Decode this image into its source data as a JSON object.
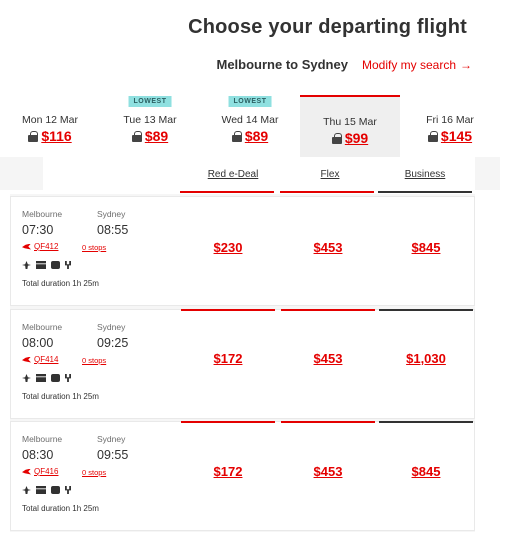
{
  "page": {
    "title": "Choose your departing flight",
    "route": "Melbourne to Sydney",
    "modify_label": "Modify my search",
    "modify_arrow": "→"
  },
  "dates": [
    {
      "badge": "",
      "label": "Mon 12 Mar",
      "price": "$116",
      "selected": false
    },
    {
      "badge": "LOWEST",
      "label": "Tue 13 Mar",
      "price": "$89",
      "selected": false
    },
    {
      "badge": "LOWEST",
      "label": "Wed 14 Mar",
      "price": "$89",
      "selected": false
    },
    {
      "badge": "",
      "label": "Thu 15 Mar",
      "price": "$99",
      "selected": true
    },
    {
      "badge": "",
      "label": "Fri 16 Mar",
      "price": "$145",
      "selected": false
    }
  ],
  "fare_types": [
    {
      "label": "Red e-Deal",
      "color": "#e40000"
    },
    {
      "label": "Flex",
      "color": "#e40000"
    },
    {
      "label": "Business",
      "color": "#323232"
    }
  ],
  "flights": [
    {
      "from_city": "Melbourne",
      "to_city": "Sydney",
      "depart": "07:30",
      "arrive": "08:55",
      "flight_no": "QF412",
      "stops": "0 stops",
      "amenities": [
        "plane-icon",
        "wifi-icon",
        "screen-icon",
        "meal-icon"
      ],
      "duration": "Total duration 1h 25m",
      "prices": [
        "$230",
        "$453",
        "$845"
      ]
    },
    {
      "from_city": "Melbourne",
      "to_city": "Sydney",
      "depart": "08:00",
      "arrive": "09:25",
      "flight_no": "QF414",
      "stops": "0 stops",
      "amenities": [
        "plane-icon",
        "wifi-icon",
        "screen-icon",
        "meal-icon"
      ],
      "duration": "Total duration 1h 25m",
      "prices": [
        "$172",
        "$453",
        "$1,030"
      ]
    },
    {
      "from_city": "Melbourne",
      "to_city": "Sydney",
      "depart": "08:30",
      "arrive": "09:55",
      "flight_no": "QF416",
      "stops": "0 stops",
      "amenities": [
        "plane-icon",
        "wifi-icon",
        "screen-icon",
        "meal-icon"
      ],
      "duration": "Total duration 1h 25m",
      "prices": [
        "$172",
        "$453",
        "$845"
      ]
    }
  ],
  "colors": {
    "accent": "#e40000",
    "badge_bg": "#8fe0e0",
    "selected_bg": "#efefef"
  }
}
